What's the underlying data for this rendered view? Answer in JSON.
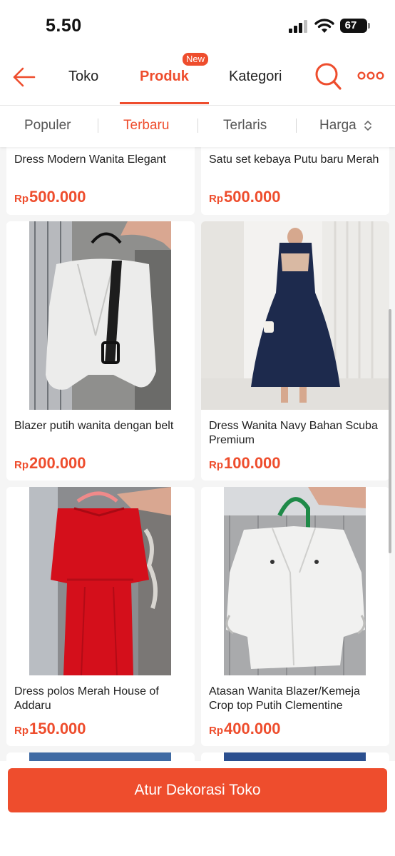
{
  "status_bar": {
    "time": "5.50",
    "battery": "67"
  },
  "header": {
    "tabs": [
      {
        "label": "Toko"
      },
      {
        "label": "Produk"
      },
      {
        "label": "Kategori"
      }
    ],
    "active_tab": "Produk",
    "new_badge": "New"
  },
  "sort": {
    "items": [
      "Populer",
      "Terbaru",
      "Terlaris",
      "Harga"
    ],
    "active": "Terbaru"
  },
  "products": [
    {
      "name": "Dress Modern Wanita Elegant",
      "currency": "Rp",
      "price": "500.000"
    },
    {
      "name": "Satu set kebaya Putu baru Merah",
      "currency": "Rp",
      "price": "500.000"
    },
    {
      "name": "Blazer putih wanita dengan belt",
      "currency": "Rp",
      "price": "200.000"
    },
    {
      "name": "Dress Wanita Navy Bahan Scuba Premium",
      "currency": "Rp",
      "price": "100.000"
    },
    {
      "name": "Dress polos Merah House of Addaru",
      "currency": "Rp",
      "price": "150.000"
    },
    {
      "name": "Atasan Wanita Blazer/Kemeja Crop top Putih Clementine",
      "currency": "Rp",
      "price": "400.000"
    }
  ],
  "cta_label": "Atur Dekorasi Toko",
  "colors": {
    "accent": "#ee4d2d",
    "background": "#f5f5f5"
  }
}
